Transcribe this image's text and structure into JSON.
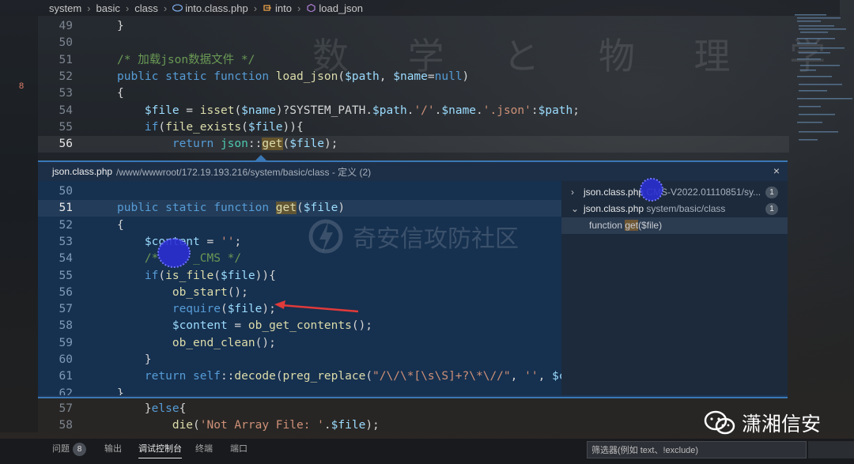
{
  "breadcrumb": {
    "items": [
      "system",
      "basic",
      "class",
      "into.class.php",
      "into",
      "load_json"
    ]
  },
  "background_text": "数 学 と 物 理 学",
  "gutter_badge": "8",
  "editor_top": [
    {
      "ln": "49",
      "tokens": [
        {
          "t": "}",
          "c": ""
        }
      ]
    },
    {
      "ln": "50",
      "tokens": []
    },
    {
      "ln": "51",
      "tokens": [
        {
          "t": "/* 加载json数据文件 */",
          "c": "cm"
        }
      ]
    },
    {
      "ln": "52",
      "tokens": [
        {
          "t": "public static function ",
          "c": "kw"
        },
        {
          "t": "load_json",
          "c": "fn"
        },
        {
          "t": "(",
          "c": ""
        },
        {
          "t": "$path",
          "c": "var"
        },
        {
          "t": ", ",
          "c": ""
        },
        {
          "t": "$name",
          "c": "var"
        },
        {
          "t": "=",
          "c": ""
        },
        {
          "t": "null",
          "c": "kw"
        },
        {
          "t": ")",
          "c": ""
        }
      ]
    },
    {
      "ln": "53",
      "tokens": [
        {
          "t": "{",
          "c": ""
        }
      ]
    },
    {
      "ln": "54",
      "tokens": [
        {
          "t": "    ",
          "c": ""
        },
        {
          "t": "$file",
          "c": "var"
        },
        {
          "t": " = ",
          "c": ""
        },
        {
          "t": "isset",
          "c": "fn"
        },
        {
          "t": "(",
          "c": ""
        },
        {
          "t": "$name",
          "c": "var"
        },
        {
          "t": ")?SYSTEM_PATH.",
          "c": ""
        },
        {
          "t": "$path",
          "c": "var"
        },
        {
          "t": ".",
          "c": ""
        },
        {
          "t": "'/'",
          "c": "str"
        },
        {
          "t": ".",
          "c": ""
        },
        {
          "t": "$name",
          "c": "var"
        },
        {
          "t": ".",
          "c": ""
        },
        {
          "t": "'.json'",
          "c": "str"
        },
        {
          "t": ":",
          "c": ""
        },
        {
          "t": "$path",
          "c": "var"
        },
        {
          "t": ";",
          "c": ""
        }
      ]
    },
    {
      "ln": "55",
      "tokens": [
        {
          "t": "    ",
          "c": ""
        },
        {
          "t": "if",
          "c": "kw"
        },
        {
          "t": "(",
          "c": ""
        },
        {
          "t": "file_exists",
          "c": "fn"
        },
        {
          "t": "(",
          "c": ""
        },
        {
          "t": "$file",
          "c": "var"
        },
        {
          "t": ")){",
          "c": ""
        }
      ]
    },
    {
      "ln": "56",
      "tokens": [
        {
          "t": "        ",
          "c": ""
        },
        {
          "t": "return ",
          "c": "kw"
        },
        {
          "t": "json",
          "c": "ct"
        },
        {
          "t": "::",
          "c": ""
        },
        {
          "t": "get",
          "c": "fn hl"
        },
        {
          "t": "(",
          "c": ""
        },
        {
          "t": "$file",
          "c": "var"
        },
        {
          "t": ");",
          "c": ""
        }
      ],
      "active": true
    }
  ],
  "peek": {
    "filename": "json.class.php",
    "path": "/www/wwwroot/172.19.193.216/system/basic/class - 定义 (2)",
    "close": "×",
    "code": [
      {
        "ln": "50",
        "tokens": []
      },
      {
        "ln": "51",
        "tokens": [
          {
            "t": "public static function ",
            "c": "kw"
          },
          {
            "t": "get",
            "c": "fn hl"
          },
          {
            "t": "(",
            "c": ""
          },
          {
            "t": "$file",
            "c": "var"
          },
          {
            "t": ")",
            "c": ""
          }
        ],
        "active": true
      },
      {
        "ln": "52",
        "tokens": [
          {
            "t": "{",
            "c": ""
          }
        ]
      },
      {
        "ln": "53",
        "tokens": [
          {
            "t": "    ",
            "c": ""
          },
          {
            "t": "$content",
            "c": "var"
          },
          {
            "t": " = ",
            "c": ""
          },
          {
            "t": "''",
            "c": "str"
          },
          {
            "t": ";",
            "c": ""
          }
        ]
      },
      {
        "ln": "54",
        "tokens": [
          {
            "t": "    ",
            "c": ""
          },
          {
            "t": "/*     _CMS */",
            "c": "cm"
          }
        ]
      },
      {
        "ln": "55",
        "tokens": [
          {
            "t": "    ",
            "c": ""
          },
          {
            "t": "if",
            "c": "kw"
          },
          {
            "t": "(",
            "c": ""
          },
          {
            "t": "is_file",
            "c": "fn"
          },
          {
            "t": "(",
            "c": ""
          },
          {
            "t": "$file",
            "c": "var"
          },
          {
            "t": ")){",
            "c": ""
          }
        ]
      },
      {
        "ln": "56",
        "tokens": [
          {
            "t": "        ",
            "c": ""
          },
          {
            "t": "ob_start",
            "c": "fn"
          },
          {
            "t": "();",
            "c": ""
          }
        ]
      },
      {
        "ln": "57",
        "tokens": [
          {
            "t": "        ",
            "c": ""
          },
          {
            "t": "require",
            "c": "kw"
          },
          {
            "t": "(",
            "c": ""
          },
          {
            "t": "$file",
            "c": "var"
          },
          {
            "t": ");",
            "c": ""
          }
        ]
      },
      {
        "ln": "58",
        "tokens": [
          {
            "t": "        ",
            "c": ""
          },
          {
            "t": "$content",
            "c": "var"
          },
          {
            "t": " = ",
            "c": ""
          },
          {
            "t": "ob_get_contents",
            "c": "fn"
          },
          {
            "t": "();",
            "c": ""
          }
        ]
      },
      {
        "ln": "59",
        "tokens": [
          {
            "t": "        ",
            "c": ""
          },
          {
            "t": "ob_end_clean",
            "c": "fn"
          },
          {
            "t": "();",
            "c": ""
          }
        ]
      },
      {
        "ln": "60",
        "tokens": [
          {
            "t": "    }",
            "c": ""
          }
        ]
      },
      {
        "ln": "61",
        "tokens": [
          {
            "t": "    ",
            "c": ""
          },
          {
            "t": "return ",
            "c": "kw"
          },
          {
            "t": "self",
            "c": "kw"
          },
          {
            "t": "::",
            "c": ""
          },
          {
            "t": "decode",
            "c": "fn"
          },
          {
            "t": "(",
            "c": ""
          },
          {
            "t": "preg_replace",
            "c": "fn"
          },
          {
            "t": "(",
            "c": ""
          },
          {
            "t": "\"/\\/\\*[\\s\\S]+?\\*\\//\"",
            "c": "str"
          },
          {
            "t": ", ",
            "c": ""
          },
          {
            "t": "''",
            "c": "str"
          },
          {
            "t": ", ",
            "c": ""
          },
          {
            "t": "$content",
            "c": "var"
          },
          {
            "t": ")",
            "c": ""
          }
        ]
      },
      {
        "ln": "62",
        "tokens": [
          {
            "t": "}",
            "c": ""
          }
        ]
      }
    ],
    "refs": [
      {
        "chev": "›",
        "name": "json.class.php",
        "path": "   CMS-V2022.01110851/sy...",
        "count": "1"
      },
      {
        "chev": "⌄",
        "name": "json.class.php",
        "path": "system/basic/class",
        "count": "1"
      }
    ],
    "ref_line_prefix": "function ",
    "ref_line_match": "get",
    "ref_line_suffix": "($file)",
    "watermark": "奇安信攻防社区"
  },
  "editor_bottom": [
    {
      "ln": "57",
      "tokens": [
        {
          "t": "    }",
          "c": ""
        },
        {
          "t": "else",
          "c": "kw"
        },
        {
          "t": "{",
          "c": ""
        }
      ]
    },
    {
      "ln": "58",
      "tokens": [
        {
          "t": "        ",
          "c": ""
        },
        {
          "t": "die",
          "c": "fn"
        },
        {
          "t": "(",
          "c": ""
        },
        {
          "t": "'Not Array File: '",
          "c": "str"
        },
        {
          "t": ".",
          "c": ""
        },
        {
          "t": "$file",
          "c": "var"
        },
        {
          "t": ");",
          "c": ""
        }
      ]
    }
  ],
  "panel_tabs": {
    "problems": "问题",
    "problems_count": "8",
    "output": "输出",
    "debug_console": "调试控制台",
    "terminal": "终端",
    "ports": "端口",
    "filter_placeholder": "筛选器(例如 text、!exclude)"
  },
  "brand": "潇湘信安",
  "colors": {
    "accent": "#3a78b5",
    "peek_bg": "#16304f",
    "arrow": "#e03a3a"
  }
}
